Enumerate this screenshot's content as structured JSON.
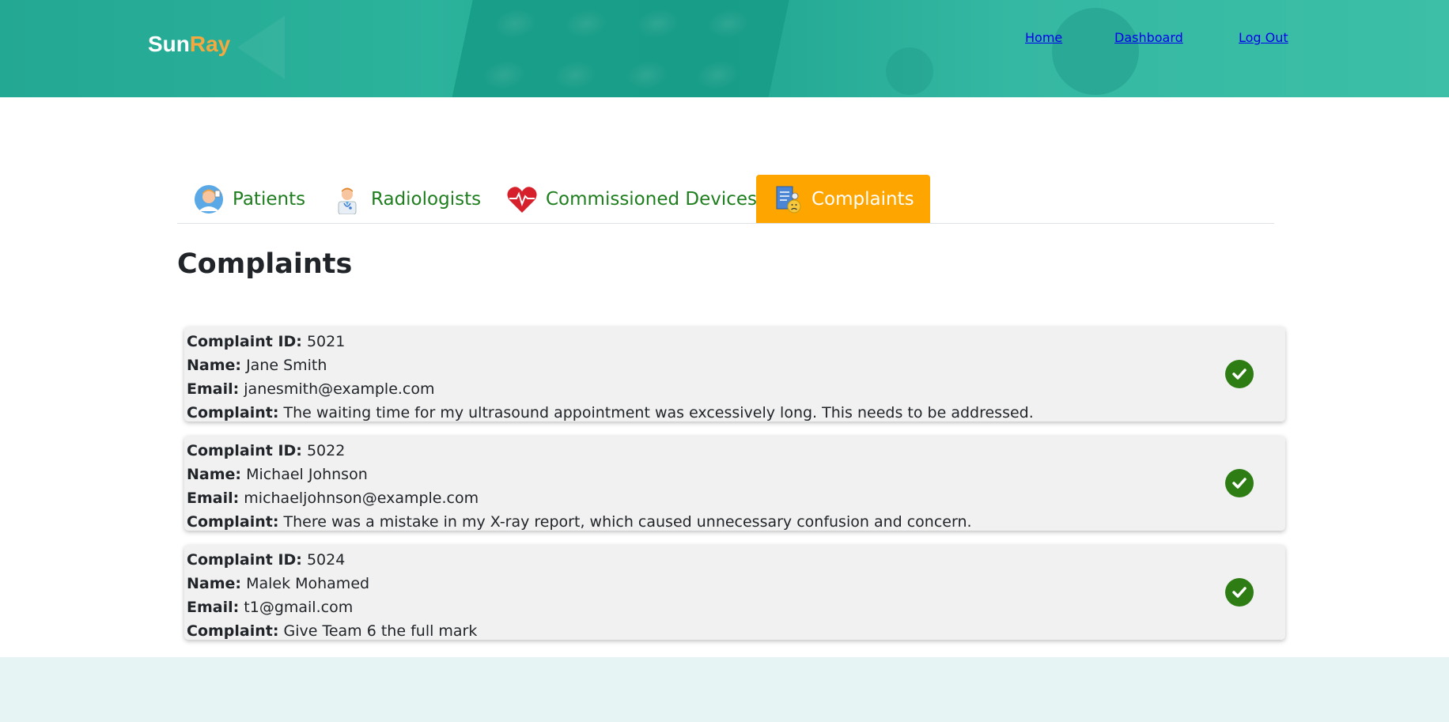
{
  "brand": {
    "part1": "Sun",
    "part2": "Ray"
  },
  "nav": {
    "home": "Home",
    "dashboard": "Dashboard",
    "logout": "Log Out"
  },
  "tabs": [
    {
      "label": "Patients",
      "icon": "patient-icon",
      "active": false
    },
    {
      "label": "Radiologists",
      "icon": "doctor-icon",
      "active": false
    },
    {
      "label": "Commissioned Devices",
      "icon": "heart-pulse-icon",
      "active": false
    },
    {
      "label": "Complaints",
      "icon": "complaint-report-icon",
      "active": true
    }
  ],
  "page_title": "Complaints",
  "labels": {
    "id": "Complaint ID:",
    "name": "Name:",
    "email": "Email:",
    "complaint": "Complaint:"
  },
  "complaints": [
    {
      "id": "5021",
      "name": "Jane Smith",
      "email": "janesmith@example.com",
      "text": "The waiting time for my ultrasound appointment was excessively long. This needs to be addressed."
    },
    {
      "id": "5022",
      "name": "Michael Johnson",
      "email": "michaeljohnson@example.com",
      "text": "There was a mistake in my X-ray report, which caused unnecessary confusion and concern."
    },
    {
      "id": "5024",
      "name": "Malek Mohamed",
      "email": "t1@gmail.com",
      "text": "Give Team 6 the full mark"
    }
  ],
  "colors": {
    "header": "#2cb39c",
    "brand_accent": "#f4a940",
    "tab_text": "#1e7e1e",
    "tab_active": "#ffa500",
    "check": "#2e7d14",
    "footer": "#e6f5f4"
  }
}
